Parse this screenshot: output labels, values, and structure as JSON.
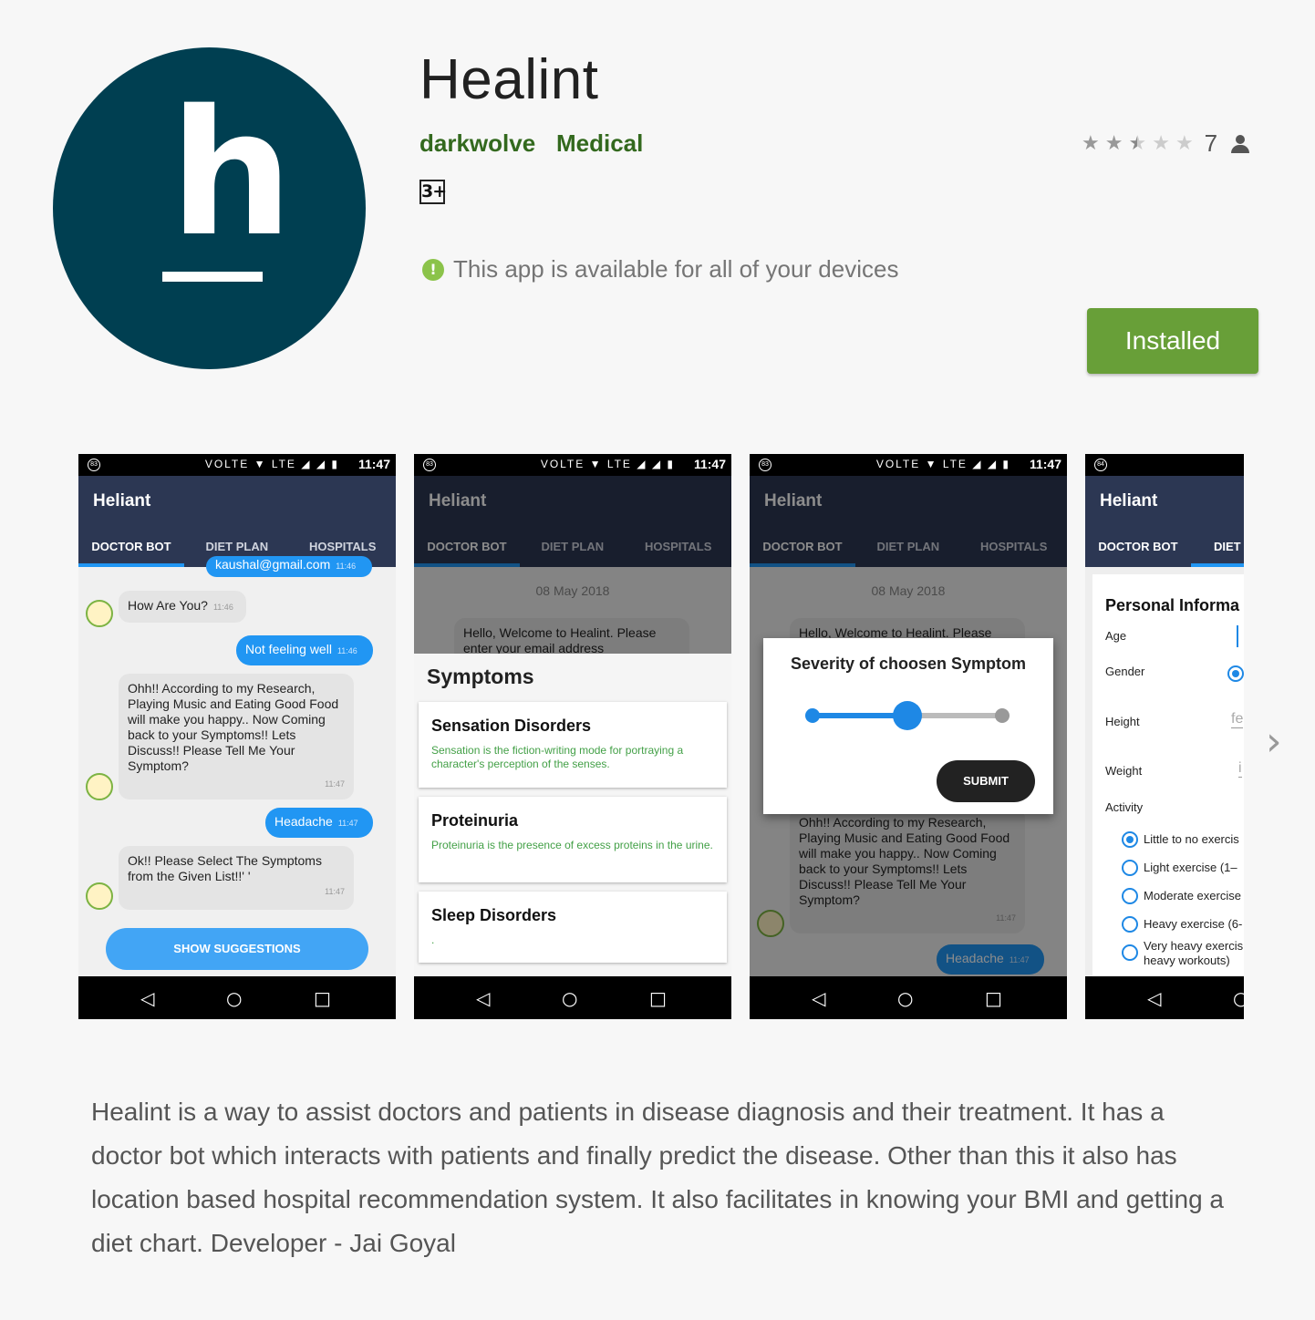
{
  "app": {
    "title": "Healint",
    "developer": "darkwolve",
    "category": "Medical",
    "age_rating": "3+",
    "rating_stars": 2.5,
    "rating_count": "7",
    "availability": "This app is available for all of your devices",
    "install_label": "Installed",
    "icon_letter": "h",
    "brand_color": "#003f51",
    "accent_color": "#689f38",
    "link_color": "#33691e"
  },
  "phones": {
    "status_time": "11:47",
    "status_badge_1": "83",
    "status_badge_4": "84",
    "status_icons": "VOLTE ▼ LTE ◢ ◢ ▮",
    "app_title": "Heliant",
    "tabs": [
      "DOCTOR BOT",
      "DIET PLAN",
      "HOSPITALS"
    ],
    "tab4_partial": "DIET I",
    "screen1": {
      "email_bubble": "kaushal@gmail.com",
      "email_ts": "11:46",
      "how_are_you": "How Are You?",
      "how_ts": "11:46",
      "not_well": "Not feeling well",
      "not_well_ts": "11:46",
      "research": "Ohh!! According to my Research, Playing Music and Eating Good Food will make you happy.. Now Coming back to your Symptoms!! Lets Discuss!! Please Tell Me Your Symptom?",
      "research_ts": "11:47",
      "headache": "Headache",
      "headache_ts": "11:47",
      "select": "Ok!! Please Select The Symptoms from the Given List!!' '",
      "select_ts": "11:47",
      "suggestions_button": "SHOW SUGGESTIONS"
    },
    "screen2": {
      "date": "08 May 2018",
      "welcome": "Hello, Welcome to Healint. Please enter your email address",
      "sheet_title": "Symptoms",
      "cards": [
        {
          "title": "Sensation Disorders",
          "desc": "Sensation is the fiction-writing mode for portraying a character's perception of the senses."
        },
        {
          "title": "Proteinuria",
          "desc": "Proteinuria is the presence of excess proteins in the urine."
        },
        {
          "title": "Sleep Disorders",
          "desc": "."
        }
      ]
    },
    "screen3": {
      "date": "08 May 2018",
      "welcome": "Hello, Welcome to Healint. Please",
      "dialog_title": "Severity of choosen Symptom",
      "slider_value": 0.5,
      "submit": "SUBMIT",
      "research": "Ohh!! According to my Research, Playing Music and Eating Good Food will make you happy.. Now Coming back to your Symptoms!! Lets Discuss!! Please Tell Me Your Symptom?",
      "research_ts": "11:47",
      "headache": "Headache",
      "headache_ts": "11:47"
    },
    "screen4": {
      "section_title": "Personal Informa",
      "age": "Age",
      "gender": "Gender",
      "height": "Height",
      "height_hint": "fe",
      "weight": "Weight",
      "weight_hint": "i",
      "activity": "Activity",
      "options": [
        "Little to no exercis",
        "Light exercise (1–",
        "Moderate exercise",
        "Heavy exercise (6-",
        "Very heavy exercis heavy workouts)"
      ],
      "selected_option": 0
    }
  },
  "description": "Healint is a way to assist doctors and patients in disease diagnosis and their treatment. It has a doctor bot which interacts with patients and finally predict the disease. Other than this it also has location based hospital recommendation system. It also facilitates in knowing your BMI and getting a diet chart. Developer - Jai Goyal"
}
